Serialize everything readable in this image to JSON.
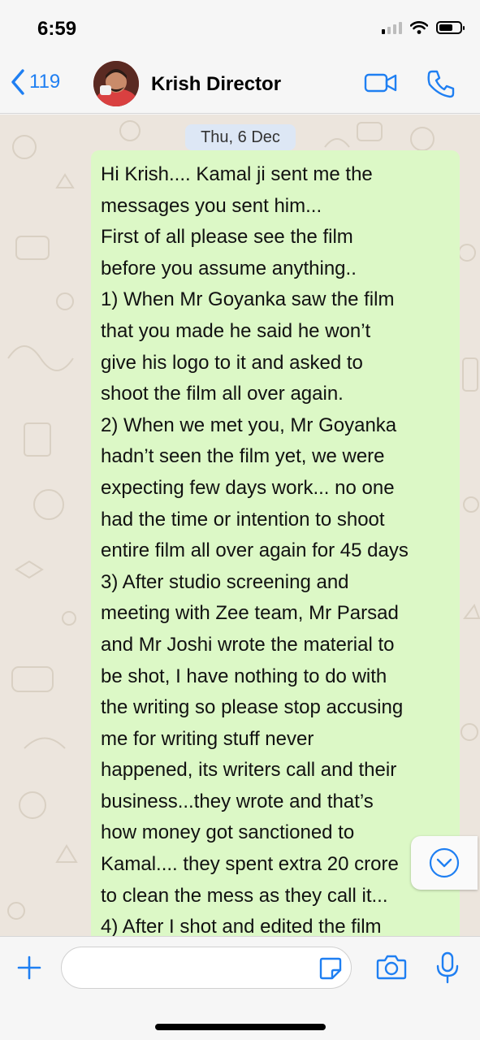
{
  "status_bar": {
    "time": "6:59",
    "signal_icon": "signal-bars-icon",
    "wifi_icon": "wifi-icon",
    "battery_icon": "battery-icon"
  },
  "header": {
    "back_icon": "chevron-left-icon",
    "back_count": "119",
    "contact_name": "Krish Director",
    "video_icon": "video-camera-icon",
    "call_icon": "phone-icon"
  },
  "chat": {
    "date_label": "Thu, 6 Dec",
    "message_lines": [
      "Hi Krish.... Kamal ji sent me the",
      "messages you sent him...",
      "First of all please see the film",
      "before you assume anything..",
      "1) When Mr Goyanka saw the film",
      "that you made he said he won’t",
      "give his logo to it and asked to",
      "shoot the film all over again.",
      "2) When we met you, Mr Goyanka",
      "hadn’t seen the film yet, we were",
      "expecting few days work... no one",
      "had the time or intention to shoot",
      "entire film all over again for 45 days",
      "3) After studio screening and",
      "meeting with Zee team, Mr Parsad",
      "and Mr Joshi wrote the material to",
      "be shot, I have nothing to do with",
      "the writing so please stop accusing",
      "me for writing stuff never",
      "happened, its writers call and their",
      "business...they wrote and that’s",
      "how money got sanctioned to",
      "Kamal.... they spent extra 20 crore",
      "to clean the mess as they call it...",
      "4) After I shot and edited the film"
    ],
    "scroll_down_icon": "chevron-down-circle-icon"
  },
  "input_bar": {
    "plus_icon": "plus-icon",
    "placeholder": "",
    "sticker_icon": "sticker-icon",
    "camera_icon": "camera-icon",
    "mic_icon": "microphone-icon"
  },
  "colors": {
    "accent": "#1f7ff2",
    "bubble": "#dcf8c6",
    "chat_background": "#ece5dd",
    "date_chip": "#dde7f5"
  }
}
